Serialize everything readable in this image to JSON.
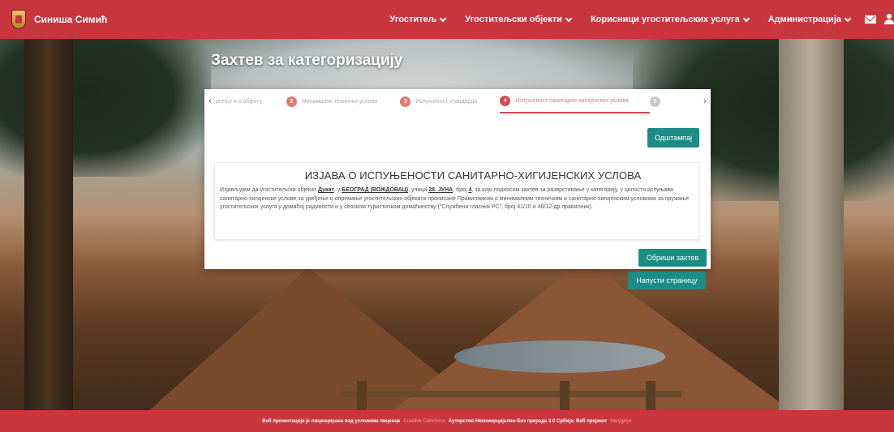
{
  "brand": {
    "name": "Синиша Симић"
  },
  "nav": {
    "items": [
      {
        "label": "Угоститељ"
      },
      {
        "label": "Угоститељски објекти"
      },
      {
        "label": "Корисници угоститељских услуга"
      },
      {
        "label": "Администрација"
      }
    ]
  },
  "page": {
    "title": "Захтев за категоризацију"
  },
  "stepper": {
    "steps": [
      {
        "num": "",
        "label": "ргељу и о објекту"
      },
      {
        "num": "2",
        "label": "Минимални технички услови"
      },
      {
        "num": "3",
        "label": "Испуњеност стандарда"
      },
      {
        "num": "4",
        "label": "Испуњеност санитарно-хигијенских услова"
      },
      {
        "num": "5",
        "label": ""
      }
    ],
    "active_index": 3
  },
  "buttons": {
    "print": "Одштампај",
    "delete": "Обриши захтев",
    "leave": "Напусти страницу"
  },
  "statement": {
    "title": "ИЗЈАВА О ИСПУЊЕНОСТИ САНИТАРНО-ХИГИЈЕНСКИХ УСЛОВА",
    "p1": "Изјављујем да угоститељски објекат ",
    "object_name": "Дукат",
    "p2": ", у ",
    "city": "БЕОГРАД (ВОЖДОВАЦ)",
    "p3": ", улица ",
    "street": "28. ЈУНА",
    "p4": ", број ",
    "number": "4",
    "p5": ", за који подносим захтев за разврставање у категорију, у целости испуњава санитарно-хигијенске услове за уређење и опремање угоститељских објеката прописане Правилником о минималним техничким и санитарно-хигијенским условима за пружање угоститељских услуга у домаћој радиности и у сеоском туристичком домаћинству (\"Службени гласник РС\", број 41/10 и 48/12-др.правилник)."
  },
  "footer": {
    "text1": "Веб презентација је лиценцирана под условима лиценце",
    "link1": "Creative Commons",
    "text2": "Ауторство-Некомерцијално-Без прерада 3.0 Србија; Веб пројекат",
    "link2": "Нелдукуе"
  },
  "colors": {
    "brand_red": "#c9363e",
    "teal": "#1c8c86",
    "step_active": "#d8484e"
  }
}
